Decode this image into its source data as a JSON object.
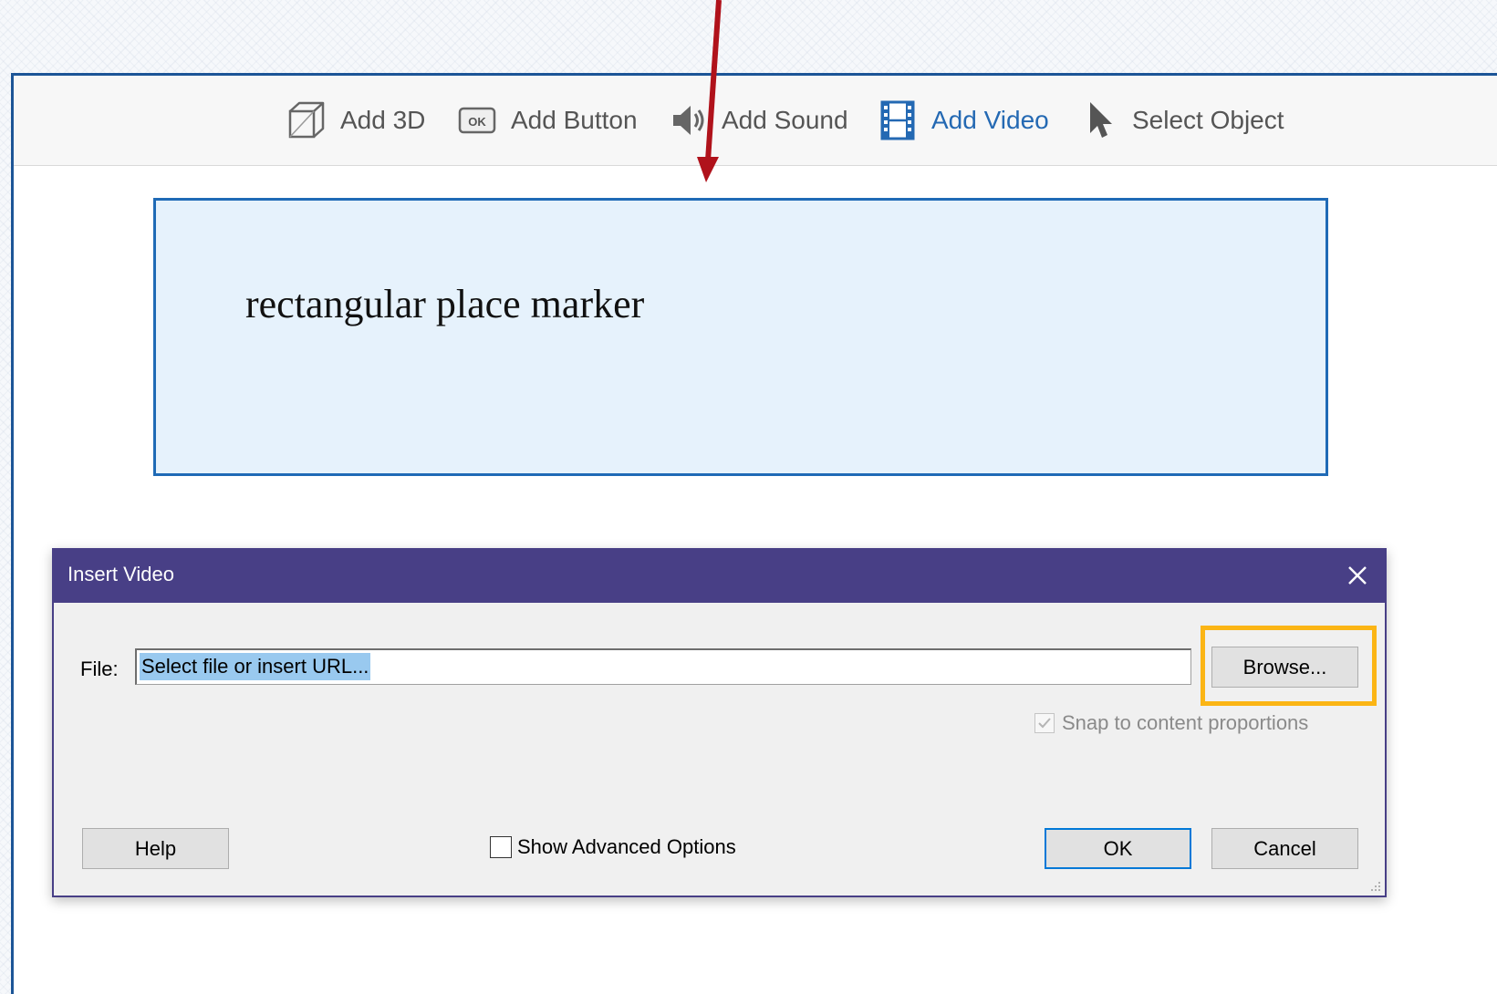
{
  "toolbar": {
    "items": [
      {
        "label": "Add 3D",
        "icon": "cube-icon"
      },
      {
        "label": "Add Button",
        "icon": "ok-button-icon"
      },
      {
        "label": "Add Sound",
        "icon": "speaker-icon"
      },
      {
        "label": "Add Video",
        "icon": "film-icon",
        "active": true
      },
      {
        "label": "Select Object",
        "icon": "cursor-arrow-icon"
      }
    ]
  },
  "placeholder": {
    "text": "rectangular place marker"
  },
  "dialog": {
    "title": "Insert Video",
    "file_label": "File:",
    "file_value": "Select file or insert URL...",
    "browse_label": "Browse...",
    "snap_label": "Snap to content proportions",
    "snap_checked": true,
    "snap_disabled": true,
    "advanced_label": "Show Advanced Options",
    "advanced_checked": false,
    "help_label": "Help",
    "ok_label": "OK",
    "cancel_label": "Cancel"
  },
  "colors": {
    "accent": "#2469b3",
    "dialog_title_bar": "#483f86",
    "highlight": "#fbb515",
    "arrow": "#b0121b",
    "selection": "#99c9ef"
  }
}
